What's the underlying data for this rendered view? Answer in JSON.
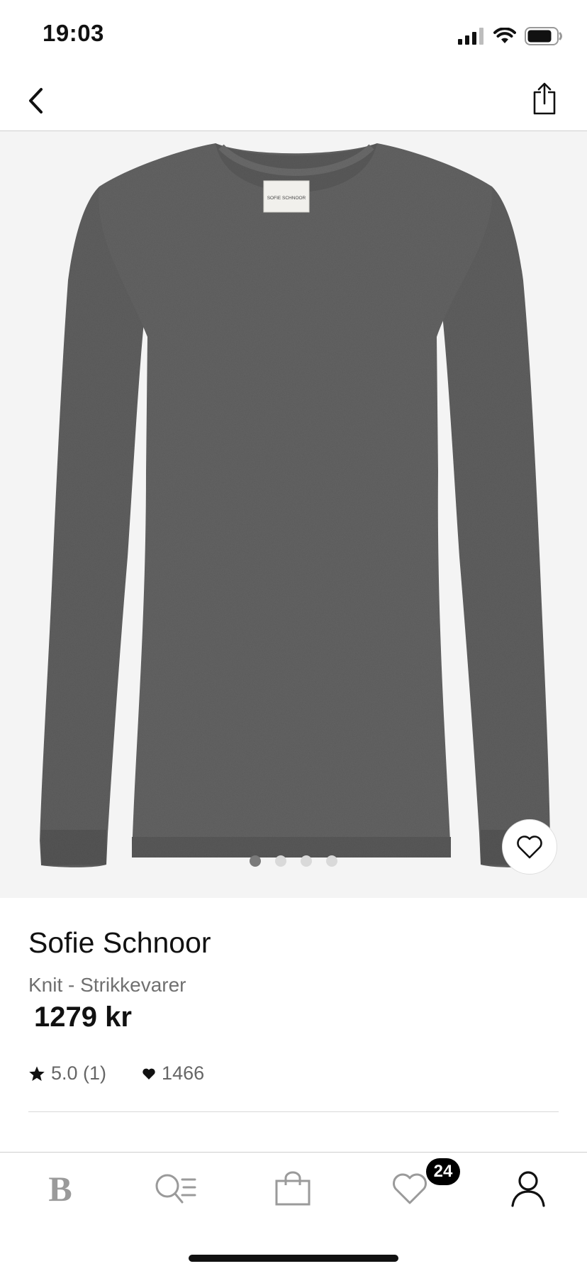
{
  "status_bar": {
    "time": "19:03",
    "icons": [
      "cellular-signal-icon",
      "wifi-icon",
      "battery-icon"
    ]
  },
  "nav": {
    "back_icon": "chevron-left-icon",
    "share_icon": "share-icon"
  },
  "gallery": {
    "image": "grey knit sweater product photo",
    "label_text": "SOFIE SCHNOOR",
    "page_count": 4,
    "current_page": 1,
    "favorite_icon": "heart-outline-icon"
  },
  "product": {
    "brand": "Sofie Schnoor",
    "category": "Knit - Strikkevarer",
    "price": "1279 kr",
    "rating": "5.0 (1)",
    "likes": "1466"
  },
  "tab_bar": {
    "tabs": [
      {
        "name": "home",
        "icon": "brand-b-logo",
        "label": "B"
      },
      {
        "name": "search",
        "icon": "search-list-icon"
      },
      {
        "name": "bag",
        "icon": "shopping-bag-icon"
      },
      {
        "name": "favorites",
        "icon": "heart-icon",
        "badge": "24"
      },
      {
        "name": "account",
        "icon": "person-icon"
      }
    ]
  },
  "colors": {
    "background": "#ffffff",
    "image_background": "#f4f4f4",
    "sweater": "#5e5e5e",
    "text_primary": "#111111",
    "text_secondary": "#707070",
    "badge": "#000000",
    "inactive_icon": "#9a9a9a"
  }
}
